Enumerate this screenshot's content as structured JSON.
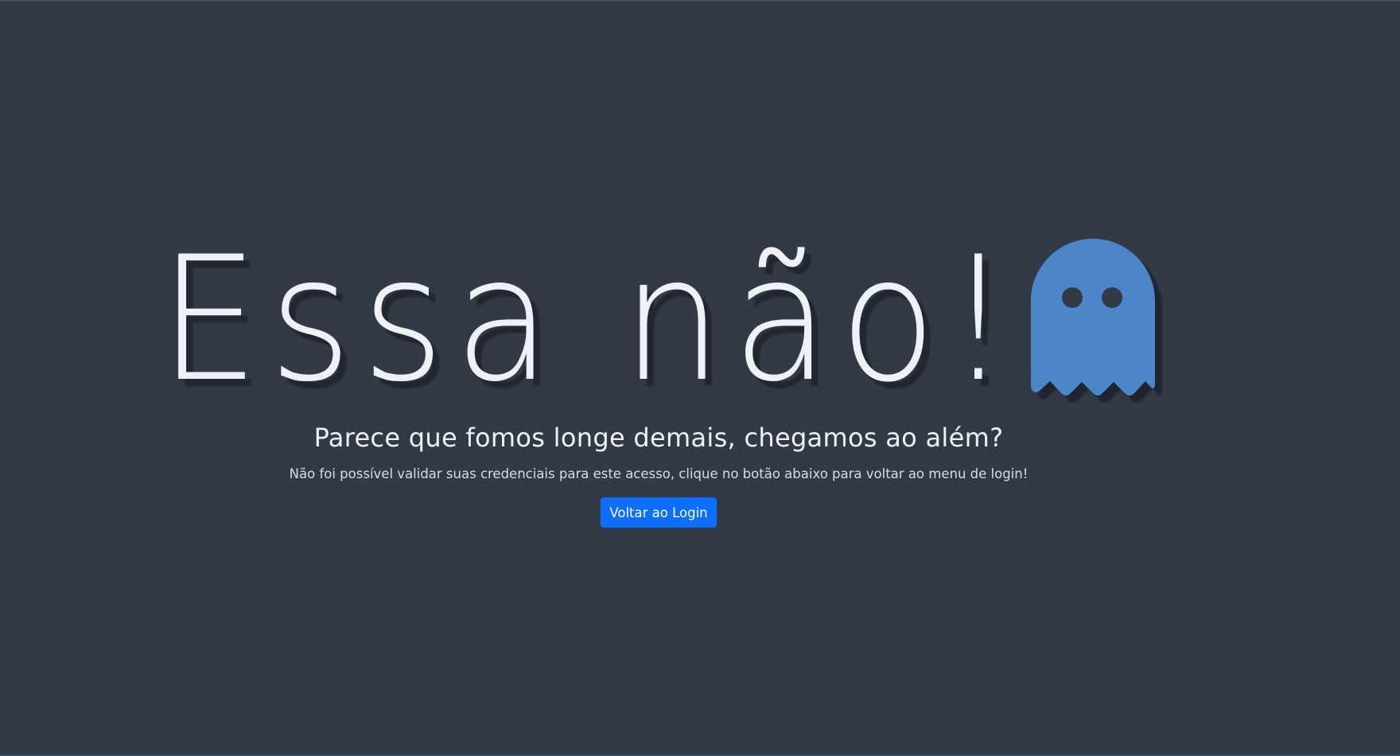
{
  "page": {
    "headline": "Essa não!",
    "subtitle": "Parece que fomos longe demais, chegamos ao além?",
    "message": "Não foi possível validar suas credenciais para este acesso, clique no botão abaixo para voltar ao menu de login!",
    "login_button_label": "Voltar ao Login",
    "ghost_icon": "ghost-icon"
  },
  "colors": {
    "background": "#323a45",
    "text": "#eef1f6",
    "ghost": "#4d86c8",
    "button": "#0d6efd"
  }
}
